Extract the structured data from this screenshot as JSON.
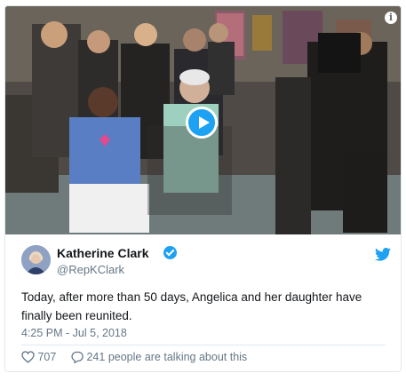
{
  "media": {
    "info_icon": "info-icon",
    "play_icon": "play-icon"
  },
  "author": {
    "name": "Katherine Clark",
    "handle": "@RepKClark",
    "verified_icon": "verified-badge-icon",
    "brand_icon": "twitter-bird-icon"
  },
  "tweet": {
    "text": "Today, after more than 50 days, Angelica and her daughter have finally been reunited.",
    "timestamp": "4:25 PM - Jul 5, 2018"
  },
  "actions": {
    "likes": "707",
    "talking": "241 people are talking about this"
  },
  "colors": {
    "brand": "#1da1f2",
    "text": "#14171a",
    "muted": "#657786",
    "border": "#e1e8ed"
  }
}
